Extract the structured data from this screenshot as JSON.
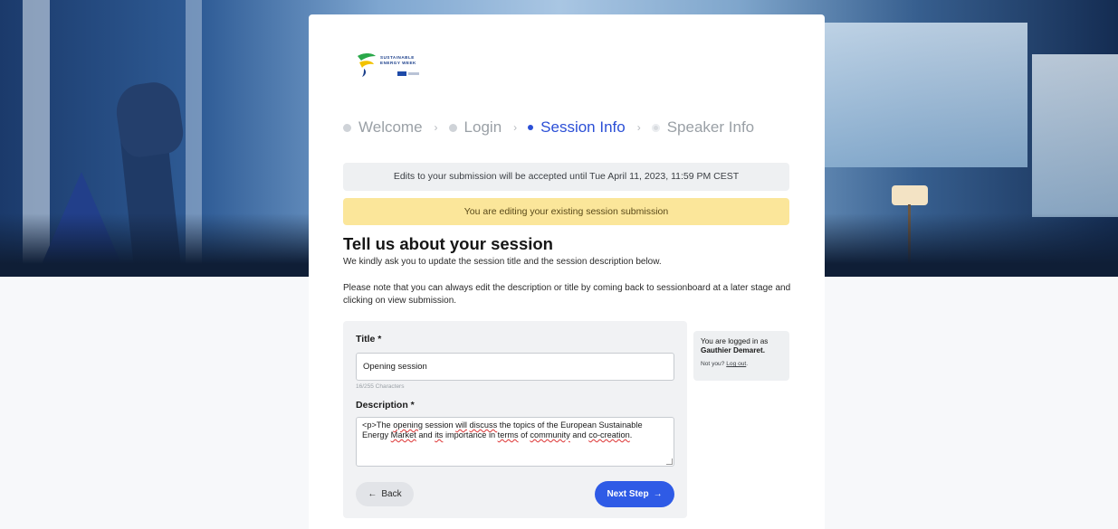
{
  "logo": {
    "line1": "SUSTAINABLE",
    "line2": "ENERGY WEEK"
  },
  "steps": [
    {
      "label": "Welcome"
    },
    {
      "label": "Login"
    },
    {
      "label": "Session Info"
    },
    {
      "label": "Speaker Info"
    }
  ],
  "steps_active_index": 2,
  "notices": {
    "deadline": "Edits to your submission will be accepted until Tue April 11, 2023, 11:59 PM CEST",
    "editing": "You are editing your existing session submission"
  },
  "page": {
    "heading": "Tell us about your session",
    "intro": "We kindly ask you to update the session title and the session description below.",
    "note": "Please note that you can always edit the description or title by coming back to sessionboard at a later stage and clicking on view submission."
  },
  "form": {
    "title_label": "Title *",
    "title_value": "Opening session",
    "title_hint": "16/255 Characters",
    "description_label": "Description *",
    "description_parts": [
      "<p>The ",
      "opening",
      " session ",
      "will",
      " ",
      "discuss",
      " the topics of the European Sustainable Energy ",
      "Market",
      " and ",
      "its",
      " importance in ",
      "terms",
      " of ",
      "community",
      " and ",
      "co-creation",
      "."
    ],
    "back_label": "Back",
    "next_label": "Next Step"
  },
  "account": {
    "line1": "You are logged in as",
    "name": "Gauthier Demaret.",
    "not_you": "Not you?",
    "logout": "Log out"
  },
  "icons": {
    "back": "arrow-left-icon",
    "next": "arrow-right-icon"
  },
  "colors": {
    "accent": "#2f5be6",
    "warning_bg": "#fbe69a",
    "muted_bg": "#eef0f2"
  }
}
